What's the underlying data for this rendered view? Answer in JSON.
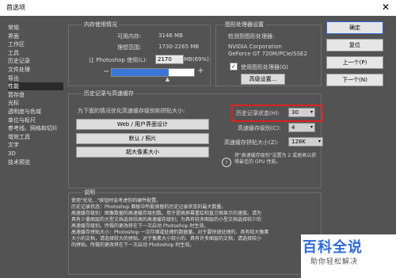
{
  "window": {
    "title": "首选项",
    "close_glyph": "✕"
  },
  "sidebar": {
    "items": [
      {
        "label": "常规"
      },
      {
        "label": "界面"
      },
      {
        "label": "工作区"
      },
      {
        "label": "工具"
      },
      {
        "label": "历史记录"
      },
      {
        "label": "文件处理"
      },
      {
        "label": "导出"
      },
      {
        "label": "性能",
        "active": true
      },
      {
        "label": "暂存盘"
      },
      {
        "label": "光标"
      },
      {
        "label": "透明度与色域"
      },
      {
        "label": "单位与标尺"
      },
      {
        "label": "参考线、网格和切片"
      },
      {
        "label": "增效工具"
      },
      {
        "label": "文字"
      },
      {
        "label": "3D"
      },
      {
        "label": "技术预览"
      }
    ]
  },
  "memory": {
    "title": "内存使用情况",
    "available_label": "可用内存:",
    "available_value": "3146 MB",
    "ideal_label": "理想范围:",
    "ideal_value": "1730-2265 MB",
    "use_label": "让 Photoshop 使用(L):",
    "use_value": "2170",
    "use_unit": "MB(69%)",
    "minus_glyph": "−",
    "plus_glyph": "+",
    "usage_fraction": 0.69
  },
  "gpu": {
    "title": "图形处理器设置",
    "detected_label": "检测到图形处理器:",
    "vendor": "NVIDIA Corporation",
    "model": "GeForce GT 720M/PCIe/SSE2",
    "use_gpu_label": "使用图形处理器(G)",
    "use_gpu_checked": true,
    "check_glyph": "✓",
    "advanced_button": "高级设置..."
  },
  "history_cache": {
    "title": "历史记录与高速缓存",
    "optimize_label": "为下面的情况优化高速缓存级别和拼贴大小:",
    "presets": [
      "Web / 用户界面设计",
      "默认 / 照片",
      "超大像素大小"
    ],
    "history_states_label": "历史记录状态(H):",
    "history_states_value": "30",
    "cache_levels_label": "高速缓存级别(C):",
    "cache_levels_value": "4",
    "tile_size_label": "高速缓存拼贴大小(Z):",
    "tile_size_value": "128K",
    "info_glyph": "i",
    "gpu_note": "将\"高速缓存级别\"设置为 2 或更高以获得最佳的 GPU 性能。",
    "arrow_glyph": "▾"
  },
  "description": {
    "title": "说明",
    "lines": [
      "使用\"优化...\"按钮时会考虑你的硬件配置。",
      "历史记录状态：Photoshop 面板中所能保留的历史记录状态的最大数量。",
      "高速缓存级别：图像数据的高速缓存级别数。用于提高屏幕重绘和直方图显示的速度。请为",
      "具有少量图层的大型文档选择较高的高速缓存级别；为具有较多图层的小型文档选择较少的",
      "高速缓存级别。所做的更改将在下一次启动 Photoshop 时生效。",
      "高速缓存拼贴大小：Photoshop 一次存储或处理的数据量。对于要快速处理的、具有较大像素",
      "大小的文档，请选择较大的拼贴。对于像素大小较小的、具有许多图层的文档，请选择较小",
      "的拼贴。所做的更改将在下一次启动 Photoshop 时生效。"
    ]
  },
  "actions": {
    "ok": "确定",
    "reset": "复位",
    "prev": "上一个(P)",
    "next": "下一个(N)"
  },
  "watermark": {
    "main": "百科全说",
    "sub": "助你轻松解决"
  }
}
